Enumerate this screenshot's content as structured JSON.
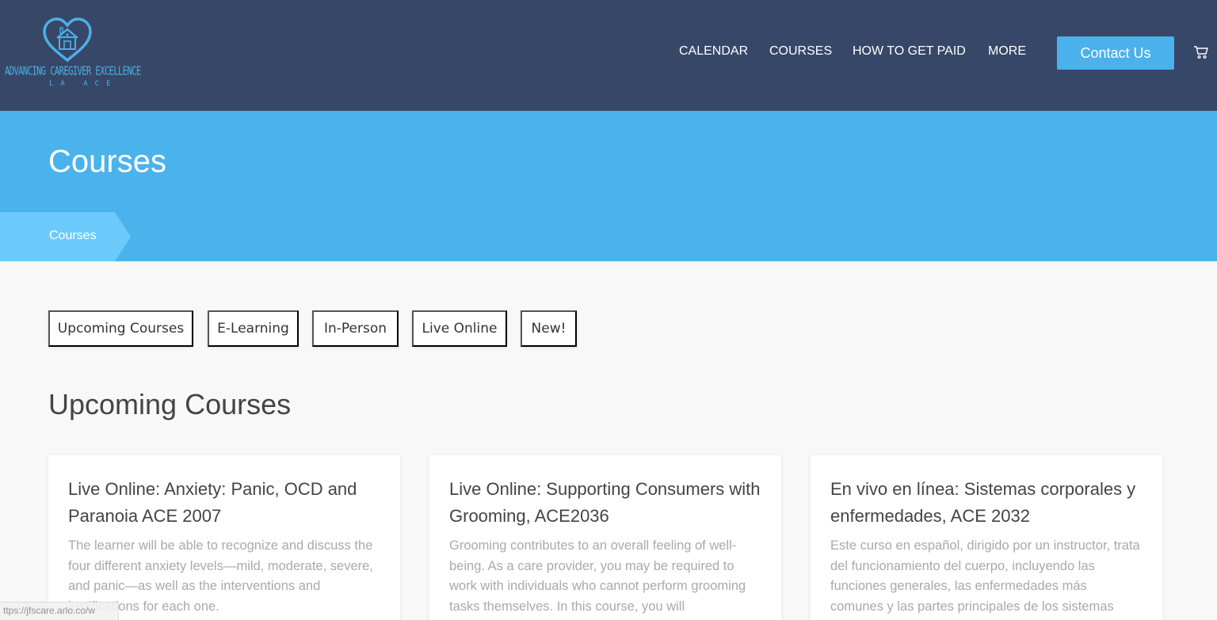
{
  "brand": {
    "name": "ADVANCING CAREGIVER EXCELLENCE",
    "sub": "LA ACE",
    "accent": "#4ab0e6"
  },
  "nav": {
    "calendar": "CALENDAR",
    "courses": "COURSES",
    "how_to_get_paid": "HOW TO GET PAID",
    "more": "MORE",
    "contact": "Contact Us",
    "cart_icon": "cart-icon"
  },
  "hero": {
    "title": "Courses",
    "breadcrumb": "Courses"
  },
  "filters": [
    "Upcoming Courses",
    "E-Learning",
    "In-Person",
    "Live Online",
    "New!"
  ],
  "section_title": "Upcoming Courses",
  "courses": [
    {
      "title": "Live Online: Anxiety: Panic, OCD and Paranoia ACE 2007",
      "description": "The learner will be able to recognize and discuss the four different anxiety levels—mild, moderate, severe, and panic—as well as the interventions and justifications for each one."
    },
    {
      "title": "Live Online: Supporting Consumers with Grooming, ACE2036",
      "description": "Grooming contributes to an overall feeling of well-being. As a care provider, you may be required to work with individuals who cannot perform grooming tasks themselves. In this course, you will"
    },
    {
      "title": "En vivo en línea: Sistemas corporales y enfermedades, ACE 2032",
      "description": "Este curso en español, dirigido por un instructor, trata del funcionamiento del cuerpo, incluyendo las funciones generales, las enfermedades más comunes y las partes principales de los sistemas"
    }
  ],
  "status_bar": {
    "url": "ttps://jfscare.arlo.co/w"
  },
  "colors": {
    "header_bg": "#374767",
    "hero_bg": "#4ab3ec",
    "breadcrumb_bg": "#6cc9fb",
    "button_bg": "#4ab1ec"
  }
}
